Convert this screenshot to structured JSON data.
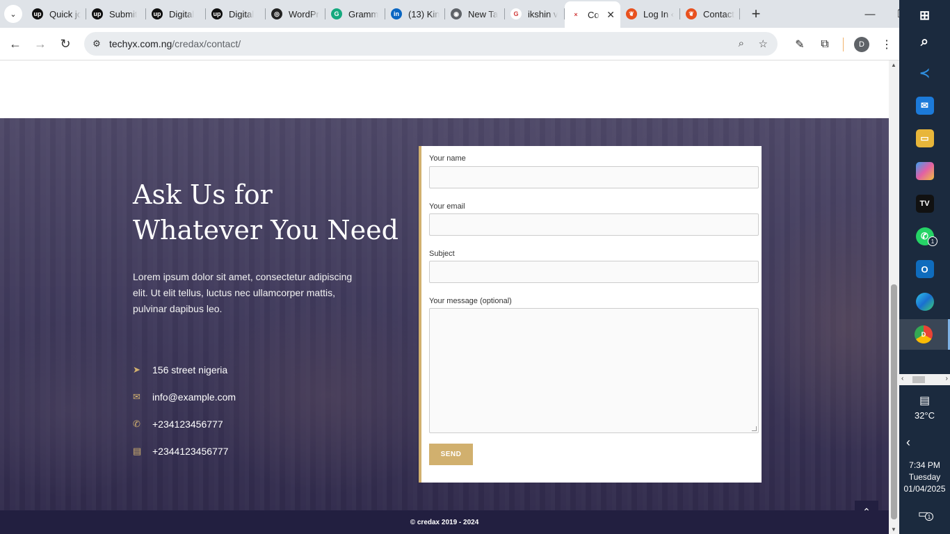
{
  "browser": {
    "tabs": [
      {
        "label": "Quick jo",
        "icon": "upwork-icon",
        "color": "#111111",
        "glyph": "up"
      },
      {
        "label": "Submit",
        "icon": "upwork-icon",
        "color": "#111111",
        "glyph": "up"
      },
      {
        "label": "Digital",
        "icon": "upwork-icon",
        "color": "#111111",
        "glyph": "up"
      },
      {
        "label": "Digital",
        "icon": "upwork-icon",
        "color": "#111111",
        "glyph": "up"
      },
      {
        "label": "WordPr",
        "icon": "openai-icon",
        "color": "#222222",
        "glyph": "◎"
      },
      {
        "label": "Gramm",
        "icon": "grammarly-icon",
        "color": "#15a97e",
        "glyph": "G"
      },
      {
        "label": "(13) Kin",
        "icon": "linkedin-icon",
        "color": "#0a66c2",
        "glyph": "in"
      },
      {
        "label": "New Ta",
        "icon": "chrome-icon",
        "color": "#5f6368",
        "glyph": "◉"
      },
      {
        "label": "ikshin v",
        "icon": "google-icon",
        "color": "#ffffff",
        "glyph": "G"
      },
      {
        "label": "Co",
        "icon": "credax-icon",
        "color": "#ffffff",
        "glyph": "×",
        "active": true
      },
      {
        "label": "Log In ‹",
        "icon": "feather-icon",
        "color": "#e8511f",
        "glyph": "❦"
      },
      {
        "label": "Contact",
        "icon": "feather-icon",
        "color": "#e8511f",
        "glyph": "❦"
      }
    ],
    "url_domain": "techyx.com.ng",
    "url_path": "/credax/contact/",
    "avatar_letter": "D"
  },
  "page": {
    "hero_title": "Ask Us for Whatever You Need",
    "hero_desc": "Lorem ipsum dolor sit amet, consectetur adipiscing elit. Ut elit tellus, luctus nec ullamcorper mattis, pulvinar dapibus leo.",
    "contacts": [
      {
        "icon": "location-arrow-icon",
        "glyph": "➤",
        "text": "156 street nigeria"
      },
      {
        "icon": "envelope-icon",
        "glyph": "✉",
        "text": "info@example.com"
      },
      {
        "icon": "phone-icon",
        "glyph": "✆",
        "text": "+234123456777"
      },
      {
        "icon": "fax-icon",
        "glyph": "▤",
        "text": "+2344123456777"
      }
    ],
    "form": {
      "name_label": "Your name",
      "email_label": "Your email",
      "subject_label": "Subject",
      "message_label": "Your message (optional)",
      "send_label": "SEND"
    },
    "footer_text": "© credax 2019 - 2024"
  },
  "taskbar": {
    "badge_whatsapp": "1",
    "chrome_profile": "D",
    "temperature": "32°C",
    "time": "7:34 PM",
    "day": "Tuesday",
    "date": "01/04/2025",
    "notif_count": "1"
  }
}
